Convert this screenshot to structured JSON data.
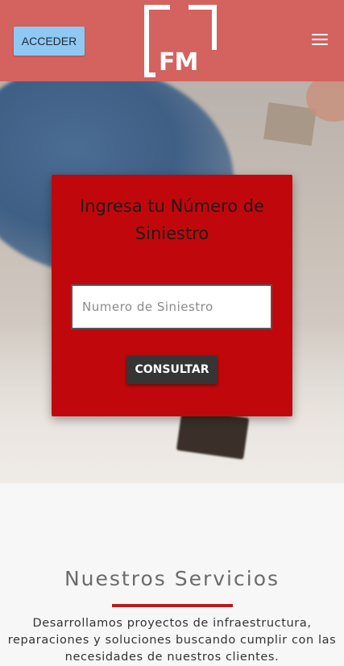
{
  "header": {
    "login_label": "ACCEDER",
    "logo_text": "FM",
    "brand_color": "#d4625f",
    "menu_icon": "hamburger-menu-icon"
  },
  "hero": {
    "card": {
      "title": "Ingresa tu Número de Siniestro",
      "input_placeholder": "Numero de Siniestro",
      "input_value": "",
      "submit_label": "CONSULTAR",
      "card_color": "#c0080c"
    }
  },
  "services": {
    "title": "Nuestros Servicios",
    "description": "Desarrollamos proyectos de infraestructura, reparaciones y soluciones buscando cumplir con las necesidades de nuestros clientes.",
    "accent_color": "#b71c1c"
  }
}
